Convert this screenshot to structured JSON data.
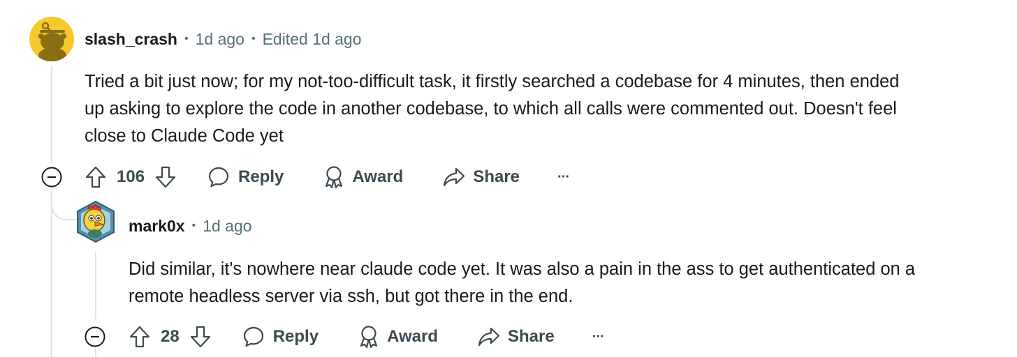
{
  "comments": [
    {
      "username": "slash_crash",
      "time": "1d ago",
      "edited": "Edited 1d ago",
      "lines": [
        "Tried a bit just now; for my not-too-difficult task, it firstly searched a codebase for 4 minutes, then ended",
        "up asking to explore the code in another codebase, to which all calls were commented out. Doesn't feel",
        "close to Claude Code yet"
      ],
      "votes": "106",
      "reply_label": "Reply",
      "award_label": "Award",
      "share_label": "Share",
      "more_label": "···"
    },
    {
      "username": "mark0x",
      "time": "1d ago",
      "lines": [
        "Did similar, it's nowhere near claude code yet. It was also a pain in the ass to get authenticated on a",
        "remote headless server via ssh, but got there in the end."
      ],
      "votes": "28",
      "reply_label": "Reply",
      "award_label": "Award",
      "share_label": "Share",
      "more_label": "···"
    }
  ],
  "colors": {
    "text": "#1a1a1b",
    "meta": "#576f76",
    "action": "#3c4a50",
    "thread": "#e0e4e7",
    "avatar_bg": "#f5c92e"
  },
  "icons": {
    "collapse": "minus-circle-icon",
    "upvote": "arrow-up-icon",
    "downvote": "arrow-down-icon",
    "reply": "speech-bubble-icon",
    "award": "award-ribbon-icon",
    "share": "share-arrow-icon"
  }
}
